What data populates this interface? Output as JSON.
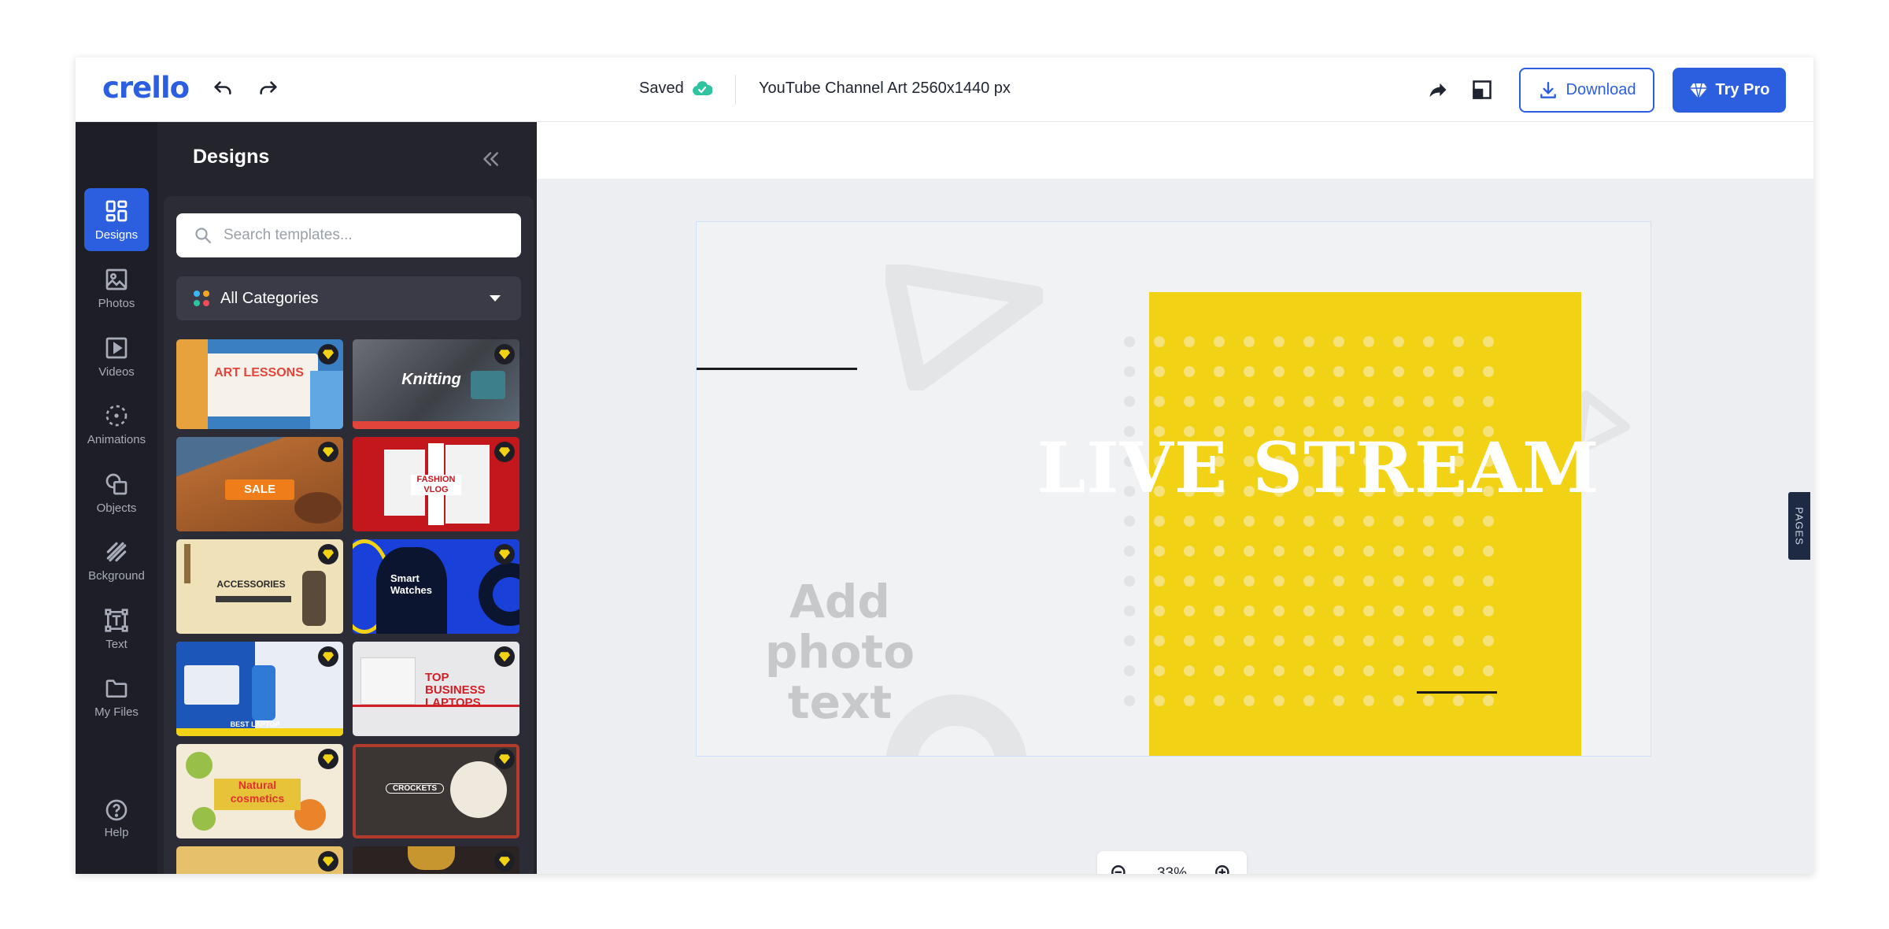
{
  "header": {
    "logo": "crello",
    "saved_label": "Saved",
    "doc_title": "YouTube Channel Art 2560x1440 px",
    "download_label": "Download",
    "try_pro_label": "Try Pro"
  },
  "rail": {
    "items": [
      {
        "label": "Designs",
        "icon": "designs-icon"
      },
      {
        "label": "Photos",
        "icon": "photos-icon"
      },
      {
        "label": "Videos",
        "icon": "videos-icon"
      },
      {
        "label": "Animations",
        "icon": "animations-icon"
      },
      {
        "label": "Objects",
        "icon": "objects-icon"
      },
      {
        "label": "Bckground",
        "icon": "background-icon"
      },
      {
        "label": "Text",
        "icon": "text-icon"
      },
      {
        "label": "My Files",
        "icon": "folder-icon"
      }
    ],
    "help_label": "Help"
  },
  "panel": {
    "title": "Designs",
    "search_placeholder": "Search templates...",
    "category_label": "All Categories",
    "thumbnails": [
      {
        "text": "ART LESSONS",
        "bg": "#3a7fc1",
        "accent": "#f29a3a"
      },
      {
        "text": "Knitting",
        "bg": "#4a4e55",
        "accent": "#e1443b"
      },
      {
        "text": "SALE",
        "bg": "#a2582b",
        "accent": "#ef7d1a"
      },
      {
        "text": "FASHION VLOG",
        "bg": "#c3171e",
        "accent": "#ffffff"
      },
      {
        "text": "ACCESSORIES",
        "bg": "#efe1b8",
        "accent": "#2b2b2b"
      },
      {
        "text": "Smart Watches",
        "bg": "#1940d8",
        "accent": "#0b1530"
      },
      {
        "text": "BEST LAPTOP",
        "bg": "#e9eef6",
        "accent": "#1c56b8"
      },
      {
        "text": "TOP BUSINESS LAPTOPS",
        "bg": "#e8e8ea",
        "accent": "#d01f26"
      },
      {
        "text": "Natural cosmetics",
        "bg": "#f3ead8",
        "accent": "#e7c33a"
      },
      {
        "text": "CROCKETS",
        "bg": "#3b3533",
        "accent": "#b23b2c"
      },
      {
        "text": "",
        "bg": "#e7c06a",
        "accent": "#ffffff"
      },
      {
        "text": "",
        "bg": "#2b2222",
        "accent": "#c8962e"
      }
    ]
  },
  "canvas": {
    "headline": "LIVE STREAM",
    "placeholder_text": "Add photo text",
    "yellow": "#f2d214",
    "pages_label": "PAGES"
  },
  "zoom": {
    "level": "33%"
  },
  "colors": {
    "brand": "#2b5fe0",
    "rail": "#1e1f26",
    "panel": "#23242c"
  }
}
